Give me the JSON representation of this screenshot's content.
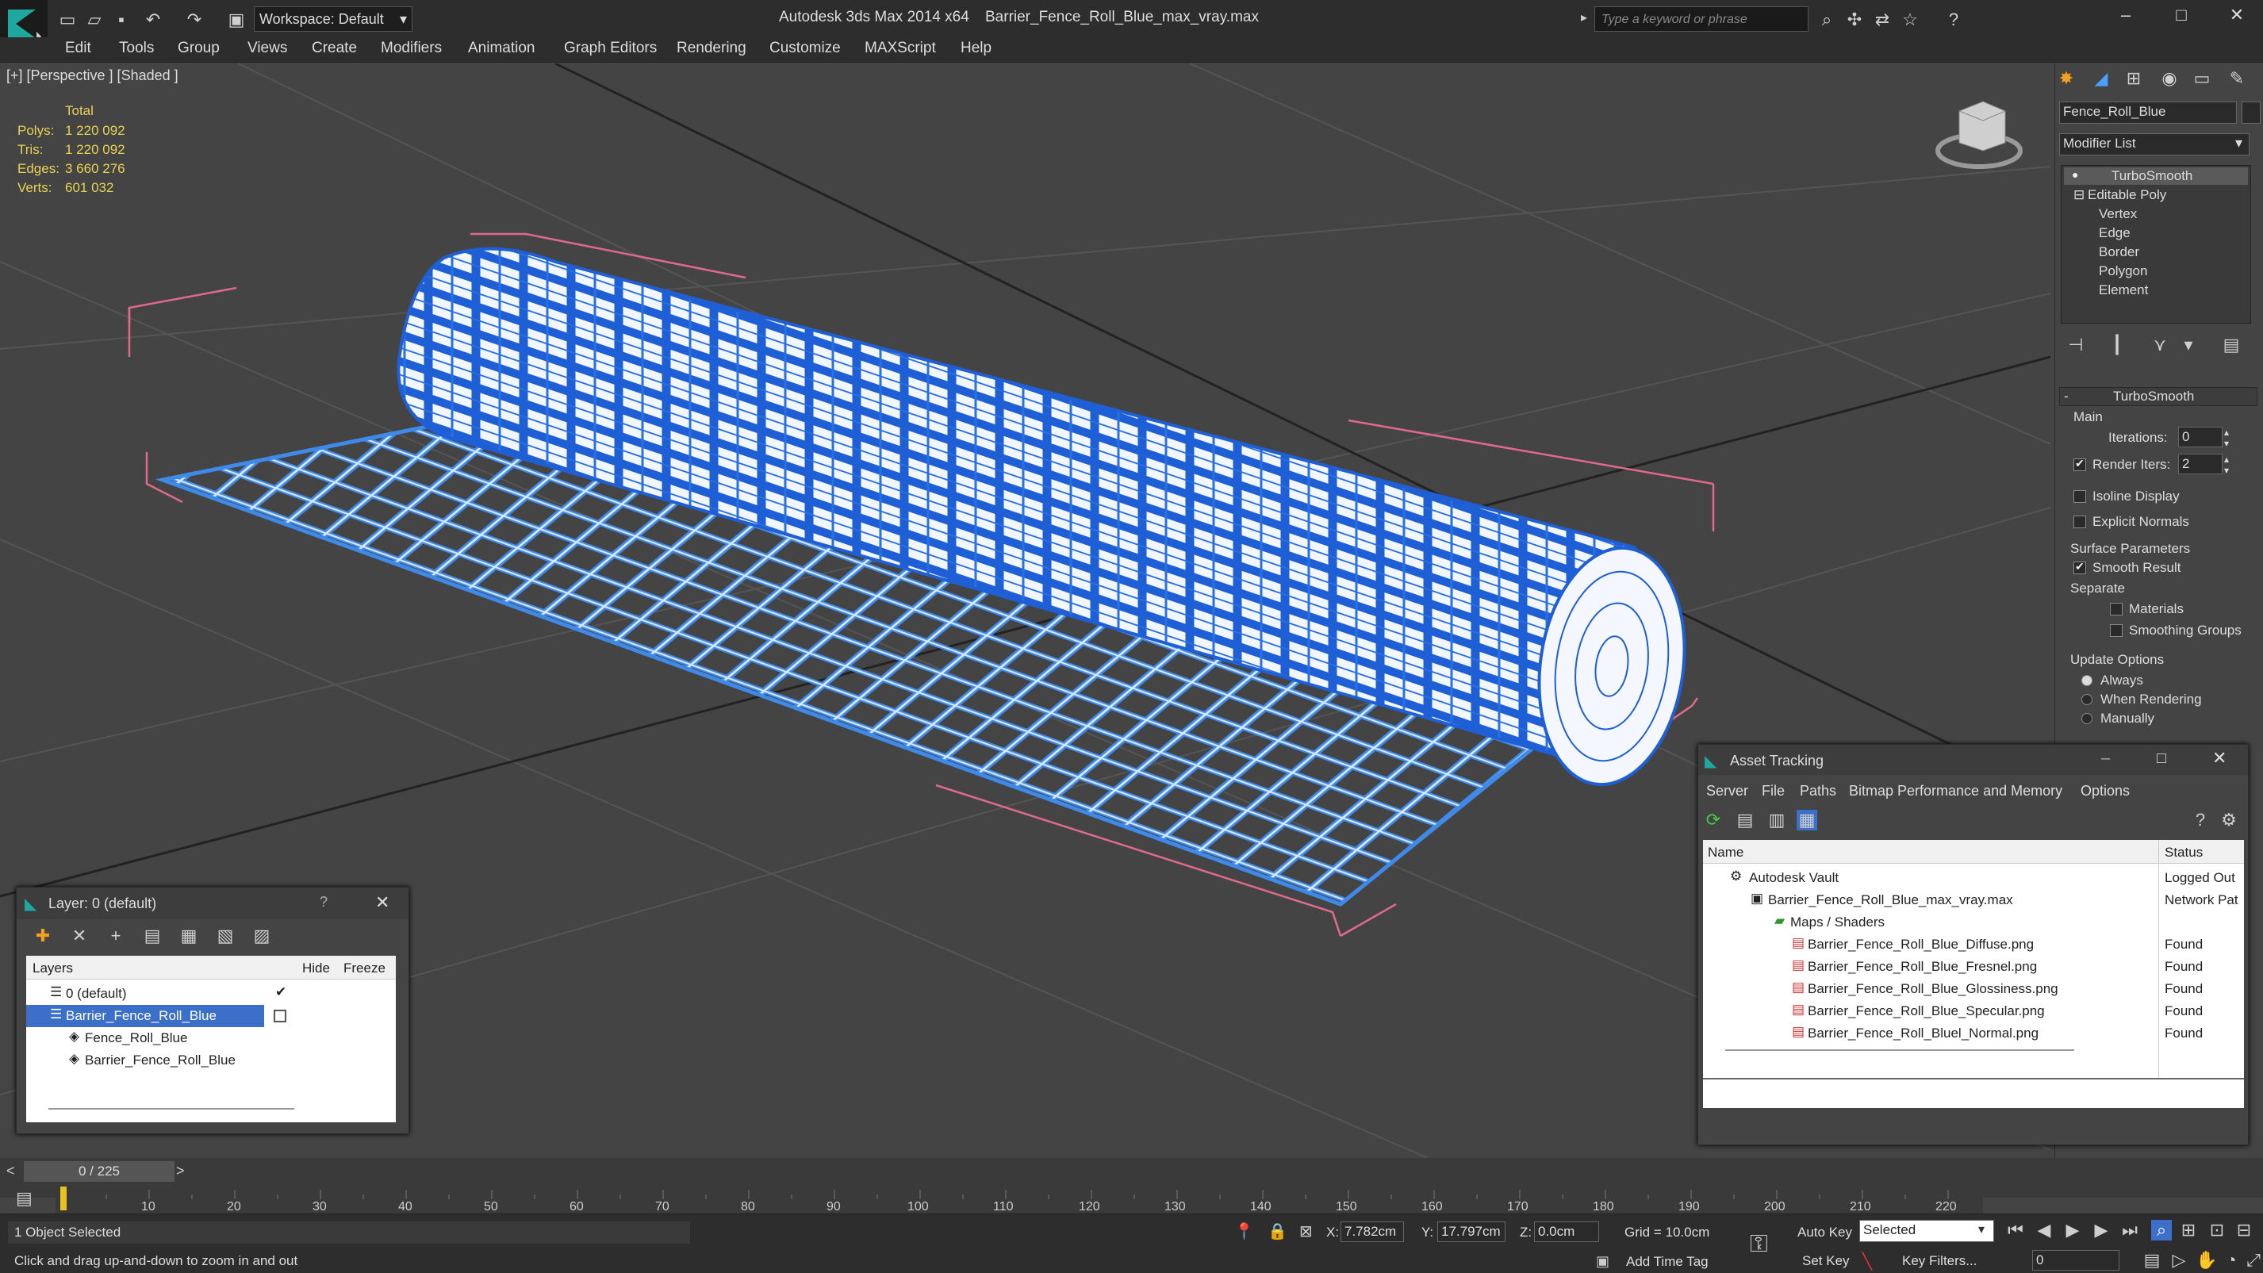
{
  "app": {
    "title": "Autodesk 3ds Max  2014 x64",
    "file": "Barrier_Fence_Roll_Blue_max_vray.max",
    "workspace": "Workspace: Default",
    "search_placeholder": "Type a keyword or phrase"
  },
  "menu": [
    "Edit",
    "Tools",
    "Group",
    "Views",
    "Create",
    "Modifiers",
    "Animation",
    "Graph Editors",
    "Rendering",
    "Customize",
    "MAXScript",
    "Help"
  ],
  "viewport": {
    "label": "[+] [Perspective ] [Shaded ]",
    "stats_header": "Total",
    "stats": [
      {
        "label": "Polys:",
        "value": "1 220 092"
      },
      {
        "label": "Tris:",
        "value": "1 220 092"
      },
      {
        "label": "Edges:",
        "value": "3 660 276"
      },
      {
        "label": "Verts:",
        "value": "601 032"
      }
    ]
  },
  "command_panel": {
    "object_name": "Fence_Roll_Blue",
    "modifier_list": "Modifier List",
    "stack": [
      "TurboSmooth",
      "Editable Poly",
      "Vertex",
      "Edge",
      "Border",
      "Polygon",
      "Element"
    ],
    "rollout_title": "TurboSmooth",
    "main_label": "Main",
    "iterations_label": "Iterations:",
    "iterations_value": "0",
    "render_iters_label": "Render Iters:",
    "render_iters_value": "2",
    "isoline": "Isoline Display",
    "explicit": "Explicit Normals",
    "surface_label": "Surface Parameters",
    "smooth_result": "Smooth Result",
    "separate": "Separate",
    "materials": "Materials",
    "smoothing_groups": "Smoothing Groups",
    "update_label": "Update Options",
    "always": "Always",
    "when_rendering": "When Rendering",
    "manually": "Manually"
  },
  "layer_window": {
    "title": "Layer: 0 (default)",
    "help": "?",
    "cols": {
      "layers": "Layers",
      "hide": "Hide",
      "freeze": "Freeze"
    },
    "rows": [
      {
        "name": "0 (default)"
      },
      {
        "name": "Barrier_Fence_Roll_Blue"
      },
      {
        "name": "Fence_Roll_Blue"
      },
      {
        "name": "Barrier_Fence_Roll_Blue"
      }
    ]
  },
  "asset_window": {
    "title": "Asset Tracking",
    "menu": [
      "Server",
      "File",
      "Paths",
      "Bitmap Performance and Memory",
      "Options"
    ],
    "cols": {
      "name": "Name",
      "status": "Status"
    },
    "rows": [
      {
        "name": "Autodesk Vault",
        "status": "Logged Out"
      },
      {
        "name": "Barrier_Fence_Roll_Blue_max_vray.max",
        "status": "Network Pat"
      },
      {
        "name": "Maps / Shaders",
        "status": ""
      },
      {
        "name": "Barrier_Fence_Roll_Blue_Diffuse.png",
        "status": "Found"
      },
      {
        "name": "Barrier_Fence_Roll_Blue_Fresnel.png",
        "status": "Found"
      },
      {
        "name": "Barrier_Fence_Roll_Blue_Glossiness.png",
        "status": "Found"
      },
      {
        "name": "Barrier_Fence_Roll_Blue_Specular.png",
        "status": "Found"
      },
      {
        "name": "Barrier_Fence_Roll_Bluel_Normal.png",
        "status": "Found"
      }
    ]
  },
  "timeline": {
    "frame": "0 / 225",
    "ticks": [
      "10",
      "20",
      "30",
      "40",
      "50",
      "60",
      "70",
      "80",
      "90",
      "100",
      "110",
      "120",
      "130",
      "140",
      "150",
      "160",
      "170",
      "180",
      "190",
      "200",
      "210",
      "220"
    ]
  },
  "status": {
    "selected": "1 Object Selected",
    "hint": "Click and drag up-and-down to zoom in and out",
    "x_label": "X:",
    "x_value": "7.782cm",
    "y_label": "Y:",
    "y_value": "17.797cm",
    "z_label": "Z:",
    "z_value": "0.0cm",
    "grid": "Grid = 10.0cm",
    "add_time_tag": "Add Time Tag",
    "auto_key": "Auto Key",
    "set_key": "Set Key",
    "selected_dropdown": "Selected",
    "key_filters": "Key Filters...",
    "frame_field": "0"
  },
  "colors": {
    "accent": "#3b6fc8",
    "stats": "#e8d255",
    "wire": "#1f5fd6"
  }
}
